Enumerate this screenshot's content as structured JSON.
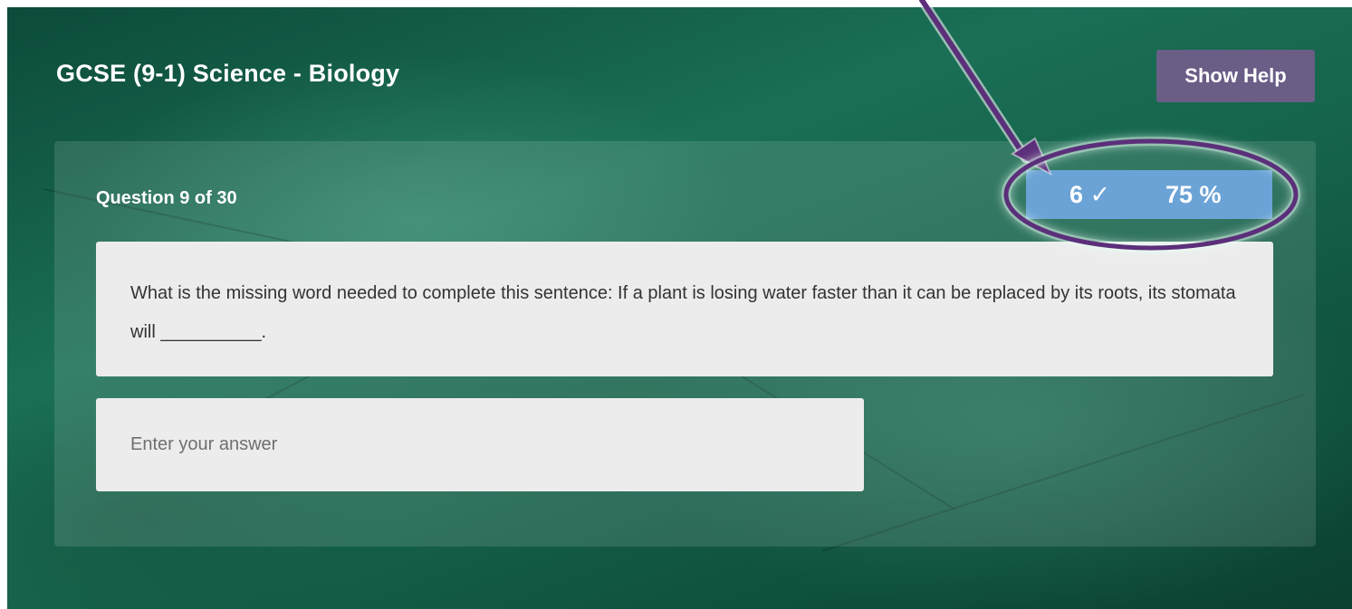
{
  "header": {
    "title": "GCSE (9-1) Science - Biology",
    "help_label": "Show Help"
  },
  "quiz": {
    "question_counter": "Question 9 of 30",
    "score": {
      "correct_count": "6 ✓",
      "percent": "75 %"
    },
    "question_text": "What is the missing word needed to complete this sentence: If a plant is losing water faster than it can be replaced by its roots, its stomata will __________.",
    "answer": {
      "value": "",
      "placeholder": "Enter your answer"
    }
  },
  "colors": {
    "background_green": "#1a6f56",
    "help_button": "#6a5d86",
    "score_badge": "#6ba3d6",
    "annotation_purple": "#5b2f7a",
    "card": "#ececec"
  },
  "icons": {
    "correct": "check-icon",
    "annotation_arrow": "arrow-icon",
    "annotation_highlight": "ellipse-highlight"
  }
}
